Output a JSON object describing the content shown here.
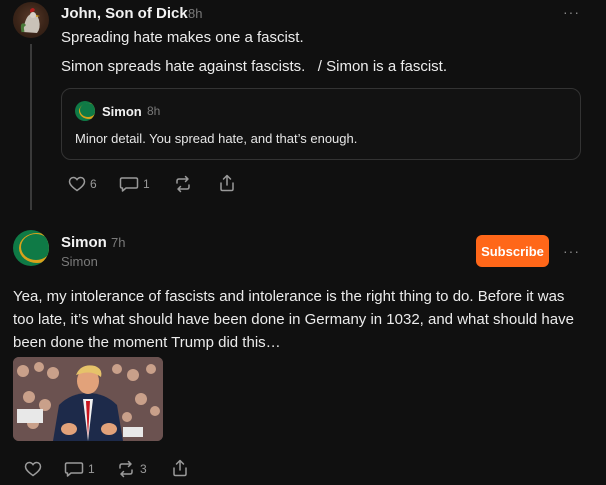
{
  "post1": {
    "author": "John, Son of Dick",
    "time": "8h",
    "lines": [
      "Spreading hate makes one a fascist.",
      "Simon spreads hate against fascists.   / Simon is a fascist."
    ],
    "quote": {
      "author": "Simon",
      "time": "8h",
      "text": "Minor detail. You spread hate, and that’s enough."
    },
    "actions": {
      "likes": "6",
      "comments": "1"
    }
  },
  "post2": {
    "author": "Simon",
    "time": "7h",
    "handle": "Simon",
    "subscribe_label": "Subscribe",
    "text": "Yea, my intolerance of fascists and intolerance is the right thing to do. Before it was too late, it’s what should have been done in Germany in 1032, and what should have been done the moment Trump did this…",
    "actions": {
      "comments": "1",
      "restacks": "3"
    }
  },
  "more_glyph": "···",
  "icons": [
    "heart-icon",
    "comment-icon",
    "restack-icon",
    "share-icon",
    "more-icon"
  ],
  "colors": {
    "background": "#101010",
    "accent": "#ff6719",
    "muted": "#7a7a7a"
  }
}
